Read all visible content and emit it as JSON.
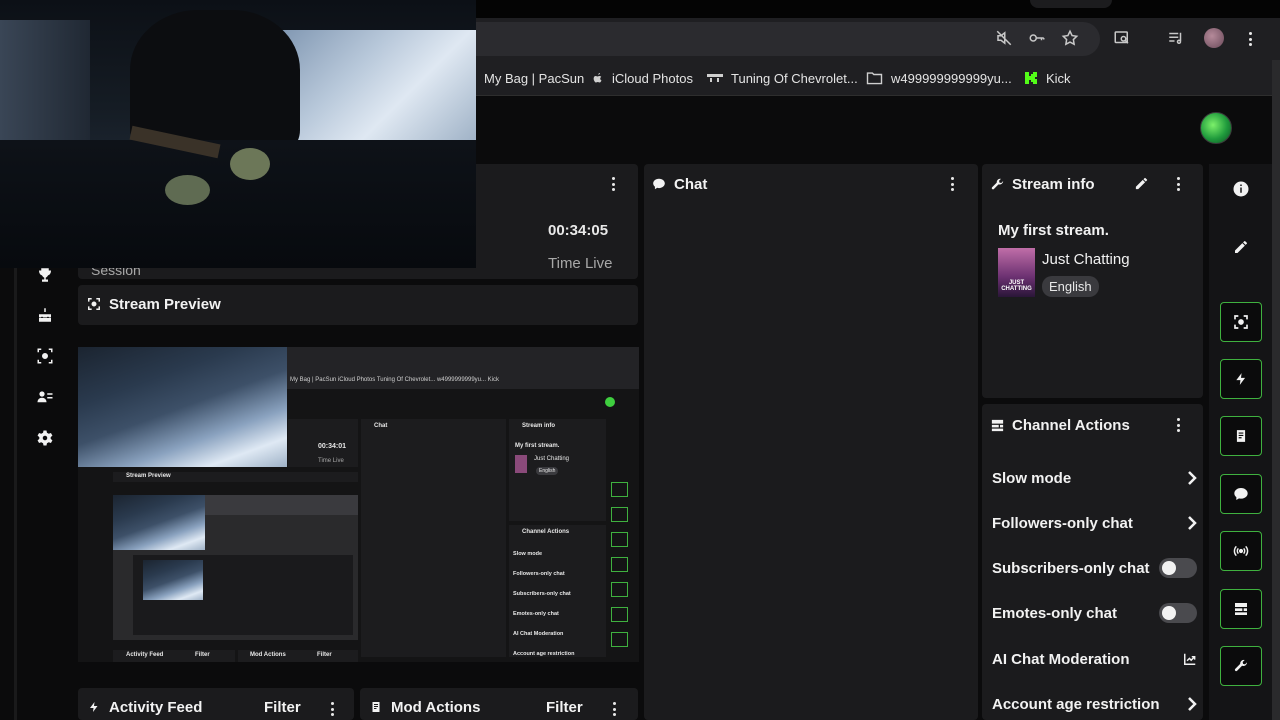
{
  "browser": {
    "bookmarks": [
      {
        "label": "My Bag | PacSun",
        "icon": "none"
      },
      {
        "label": "iCloud Photos",
        "icon": "apple-icon"
      },
      {
        "label": "Tuning Of Chevrolet...",
        "icon": "tuning-icon"
      },
      {
        "label": "w499999999999yu...",
        "icon": "folder-icon"
      },
      {
        "label": "Kick",
        "icon": "kick-icon"
      }
    ]
  },
  "session": {
    "timer": "00:34:05",
    "timer_label": "Time Live",
    "stat_labels": [
      "Session"
    ]
  },
  "stream_preview": {
    "title": "Stream Preview"
  },
  "chat": {
    "title": "Chat"
  },
  "stream_info": {
    "title": "Stream info",
    "stream_title": "My first stream.",
    "category": "Just Chatting",
    "language": "English",
    "category_art_text": "JUST CHATTING"
  },
  "channel_actions": {
    "title": "Channel Actions",
    "items": [
      {
        "label": "Slow mode",
        "control": "chevron"
      },
      {
        "label": "Followers-only chat",
        "control": "chevron"
      },
      {
        "label": "Subscribers-only chat",
        "control": "toggle"
      },
      {
        "label": "Emotes-only chat",
        "control": "toggle"
      },
      {
        "label": "AI Chat Moderation",
        "control": "external"
      },
      {
        "label": "Account age restriction",
        "control": "chevron"
      }
    ]
  },
  "activity_feed": {
    "title": "Activity Feed",
    "filter": "Filter"
  },
  "mod_actions": {
    "title": "Mod Actions",
    "filter": "Filter"
  },
  "nested_preview": {
    "timer": "00:34:01",
    "timer_label": "Time Live",
    "bookmarks": "My Bag | PacSun   iCloud Photos   Tuning Of Chevrolet...   w4999999999yu...   Kick",
    "chat": "Chat",
    "stream_info": "Stream info",
    "stream_title": "My first stream.",
    "category": "Just Chatting",
    "language": "English",
    "stream_preview": "Stream Preview",
    "channel_actions": "Channel Actions",
    "actions": [
      "Slow mode",
      "Followers-only chat",
      "Subscribers-only chat",
      "Emotes-only chat",
      "AI Chat Moderation",
      "Account age restriction"
    ],
    "activity_feed": "Activity Feed",
    "mod_actions": "Mod Actions",
    "filter": "Filter"
  },
  "colors": {
    "accent": "#3fb13f",
    "panel": "#1b1b1d",
    "background": "#0b0b0c"
  }
}
